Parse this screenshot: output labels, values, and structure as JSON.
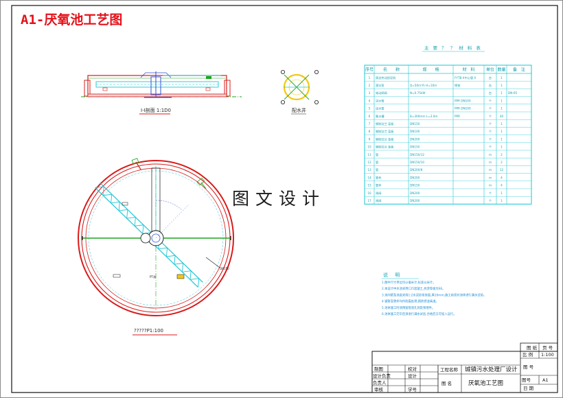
{
  "sheet": {
    "title": "A1-厌氧池工艺图",
    "watermark": "图文设计",
    "colors": {
      "title": "#e5101a",
      "tank_red": "#d81a1a",
      "cyan": "#1cc6d6",
      "green": "#1aa61a",
      "yellow": "#f2c80f",
      "blue": "#2d4fd8",
      "frame": "#111111"
    }
  },
  "section_view": {
    "caption": "I-I剖面 1:1D0"
  },
  "distribution_well": {
    "caption": "配水井"
  },
  "plan_view": {
    "caption": "?????P1:100",
    "label_dn": "DN150",
    "label_pt": "PT流"
  },
  "materials_table": {
    "title": "主 要 ？ ？ 材 料 表",
    "headers": [
      "序号",
      "名　　称",
      "规　　格",
      "材　料",
      "单位",
      "数量",
      "备　注"
    ],
    "rows": [
      [
        "1",
        "周边传动刮泥机",
        "",
        "FYTB-4中心管 0",
        "台",
        "1",
        ""
      ],
      [
        "2",
        "潜水泵",
        "Q=50m³/h H=10m",
        "铸铁",
        "台",
        "1",
        ""
      ],
      [
        "3",
        "电动闸阀",
        "N=0.75kW",
        "",
        "台",
        "1",
        "DN-65"
      ],
      [
        "4",
        "进水管",
        "",
        "PPR DN100",
        "个",
        "1",
        ""
      ],
      [
        "5",
        "出水管",
        "",
        "PPR DN100",
        "个",
        "1",
        ""
      ],
      [
        "6",
        "集水槽",
        "B=300mm L=3.0m",
        "PPR",
        "个",
        "40",
        ""
      ],
      [
        "7",
        "钢制法兰 盲板",
        "DN150",
        "",
        "个",
        "1",
        ""
      ],
      [
        "8",
        "钢制法兰 盲板",
        "DN100",
        "",
        "个",
        "1",
        ""
      ],
      [
        "9",
        "钢制法兰 盲板",
        "DN200",
        "",
        "个",
        "1",
        ""
      ],
      [
        "10",
        "钢制法兰 盲板",
        "DN150",
        "",
        "个",
        "1",
        ""
      ],
      [
        "11",
        "管",
        "DN150/12",
        "",
        "m",
        "2",
        ""
      ],
      [
        "12",
        "管",
        "DN150/10",
        "",
        "m",
        "2",
        ""
      ],
      [
        "13",
        "管",
        "DN200/8",
        "",
        "m",
        "12",
        ""
      ],
      [
        "14",
        "管件",
        "DN200",
        "",
        "m",
        "4",
        ""
      ],
      [
        "15",
        "管件",
        "DN150",
        "",
        "m",
        "4",
        ""
      ],
      [
        "16",
        "闸阀",
        "DN200",
        "",
        "个",
        "1",
        ""
      ],
      [
        "17",
        "闸阀",
        "DN200",
        "",
        "个",
        "1",
        ""
      ]
    ]
  },
  "notes": {
    "title": "说 明",
    "lines": [
      "1.图中尺寸单位均以毫米计,标高以米计。",
      "2.本设计中水池采用C25混凝土,抗渗等级为S6。",
      "3.池内壁及池底采用1:2水泥砂浆抹面,厚20mm,施工前须对池体进行满水试验。",
      "4.钢管及管件均作防腐处理,刷防锈漆两道。",
      "5.池体施工时须预留管道孔洞及预埋件。",
      "6.池体施工完毕后须进行满水试验,合格后方可投入运行。"
    ]
  },
  "title_block": {
    "drawing_label": "图 纸",
    "sheet_no_label": "图 号",
    "scale_label": "比 例",
    "scale": "1:100",
    "drawn_label": "制图",
    "design_lead_label": "设计负责",
    "owner_label": "负责人",
    "review_label": "审核",
    "check_label": "校对",
    "design_label": "设计",
    "student_label": "学号",
    "project_label": "工程名称",
    "project_name": "城镇污水处理厂设计",
    "drawing_name_label": "图 名",
    "drawing_name": "厌氧池工艺图",
    "number_label": "图号",
    "number_value": "A1",
    "date_label": "日 期",
    "pages_label": "页 号"
  }
}
